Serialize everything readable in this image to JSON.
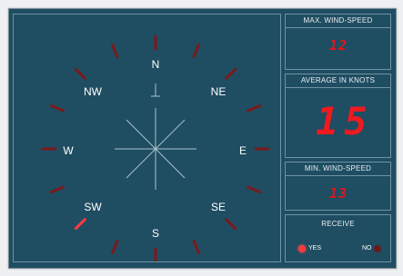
{
  "compass": {
    "directions": {
      "n": "N",
      "ne": "NE",
      "e": "E",
      "se": "SE",
      "s": "S",
      "sw": "SW",
      "w": "W",
      "nw": "NW"
    },
    "wind_direction_deg": 225
  },
  "panels": {
    "max": {
      "title": "MAX. WIND-SPEED",
      "value": "12"
    },
    "avg": {
      "title": "AVERAGE IN KNOTS",
      "value": "15"
    },
    "min": {
      "title": "MIN. WIND-SPEED",
      "value": "13"
    },
    "receive": {
      "title": "RECEIVE",
      "yes_label": "YES",
      "no_label": "NO"
    }
  },
  "colors": {
    "background": "#1f4d62",
    "tick_inactive": "#7a1a1c",
    "tick_active": "#ff3a3a",
    "lcd": "#e0161e",
    "led_yes": "#ff3b3b",
    "led_no": "#6a1a1c"
  }
}
